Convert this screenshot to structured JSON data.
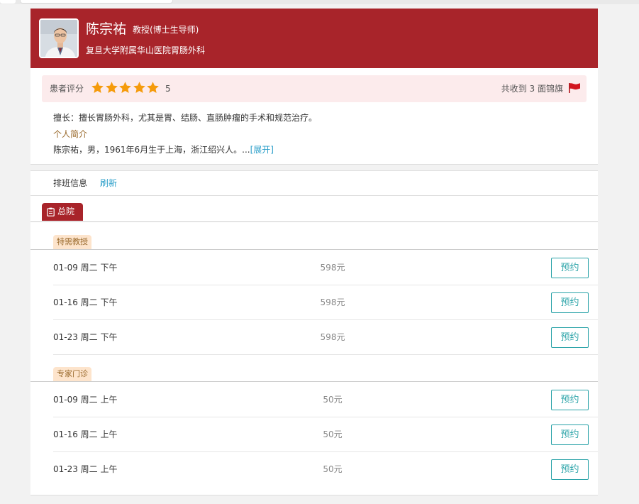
{
  "doctor": {
    "name": "陈宗祐",
    "title": "教授(博士生导师)",
    "hospital": "复旦大学附属华山医院胃肠外科"
  },
  "rating": {
    "label": "患者评分",
    "stars": 5,
    "value": "5",
    "banner_text": "共收到 3 面锦旗"
  },
  "profile": {
    "specialty": "擅长：擅长胃肠外科，尤其是胃、结肠、直肠肿瘤的手术和规范治疗。",
    "intro_title": "个人简介",
    "intro_text": "陈宗祐，男，1961年6月生于上海，浙江绍兴人。...",
    "expand_label": "[展开]"
  },
  "schedule": {
    "label": "排班信息",
    "refresh_label": "刷新",
    "campus": "总院",
    "categories": [
      {
        "name": "特需教授",
        "slots": [
          {
            "date": "01-09 周二 下午",
            "price": "598元",
            "action": "预约"
          },
          {
            "date": "01-16 周二 下午",
            "price": "598元",
            "action": "预约"
          },
          {
            "date": "01-23 周二 下午",
            "price": "598元",
            "action": "预约"
          }
        ]
      },
      {
        "name": "专家门诊",
        "slots": [
          {
            "date": "01-09 周二 上午",
            "price": "50元",
            "action": "预约"
          },
          {
            "date": "01-16 周二 上午",
            "price": "50元",
            "action": "预约"
          },
          {
            "date": "01-23 周二 上午",
            "price": "50元",
            "action": "预约"
          }
        ]
      }
    ]
  },
  "colors": {
    "header_bg": "#a8242a",
    "rating_bg": "#fcebec",
    "star": "#f59b0c",
    "accent_link": "#2a9ec9",
    "book_button": "#2aa3a8",
    "tag_bg": "#fde4cc",
    "tag_text": "#9a6a2c"
  },
  "icons": {
    "star": "star-icon",
    "flag": "flag-icon",
    "campus": "clipboard-icon"
  }
}
